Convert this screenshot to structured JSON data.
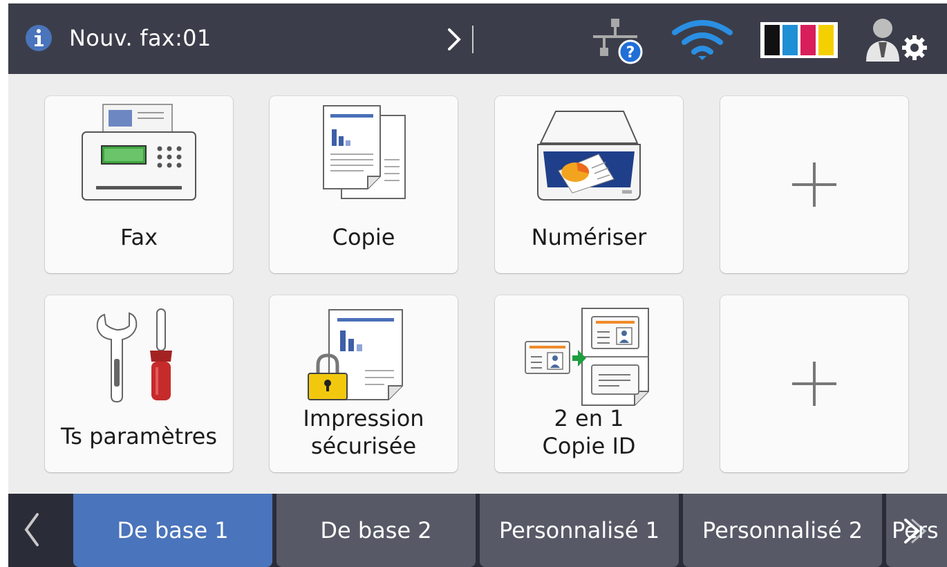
{
  "status_bar": {
    "new_fax_text": "Nouv. fax:01",
    "icons": [
      "info-icon",
      "next-arrow-icon",
      "wired-network-unknown-icon",
      "wifi-icon",
      "ink-levels-icon",
      "admin-settings-icon"
    ]
  },
  "tiles": [
    {
      "label": "Fax",
      "icon": "fax-machine-icon"
    },
    {
      "label": "Copie",
      "icon": "copy-documents-icon"
    },
    {
      "label": "Numériser",
      "icon": "scanner-icon"
    },
    {
      "label": "",
      "icon": "plus-icon"
    },
    {
      "label": "Ts paramètres",
      "icon": "wrench-screwdriver-icon"
    },
    {
      "label_line1": "Impression",
      "label_line2": "sécurisée",
      "icon": "secure-print-icon"
    },
    {
      "label_line1": "2 en 1",
      "label_line2": "Copie ID",
      "icon": "id-copy-icon"
    },
    {
      "label": "",
      "icon": "plus-icon"
    }
  ],
  "tabs": {
    "items": [
      "De base 1",
      "De base 2",
      "Personnalisé 1",
      "Personnalisé 2",
      "Pers"
    ],
    "active": "De base 1"
  },
  "colors": {
    "status_bar_bg": "#3b3e4a",
    "active_tab": "#4a74bb",
    "inactive_tab": "#575a66",
    "ink_black": "#111111",
    "ink_cyan": "#1f8fd6",
    "ink_magenta": "#d81e5b",
    "ink_yellow": "#f5d000",
    "wifi": "#2a8fe3"
  }
}
